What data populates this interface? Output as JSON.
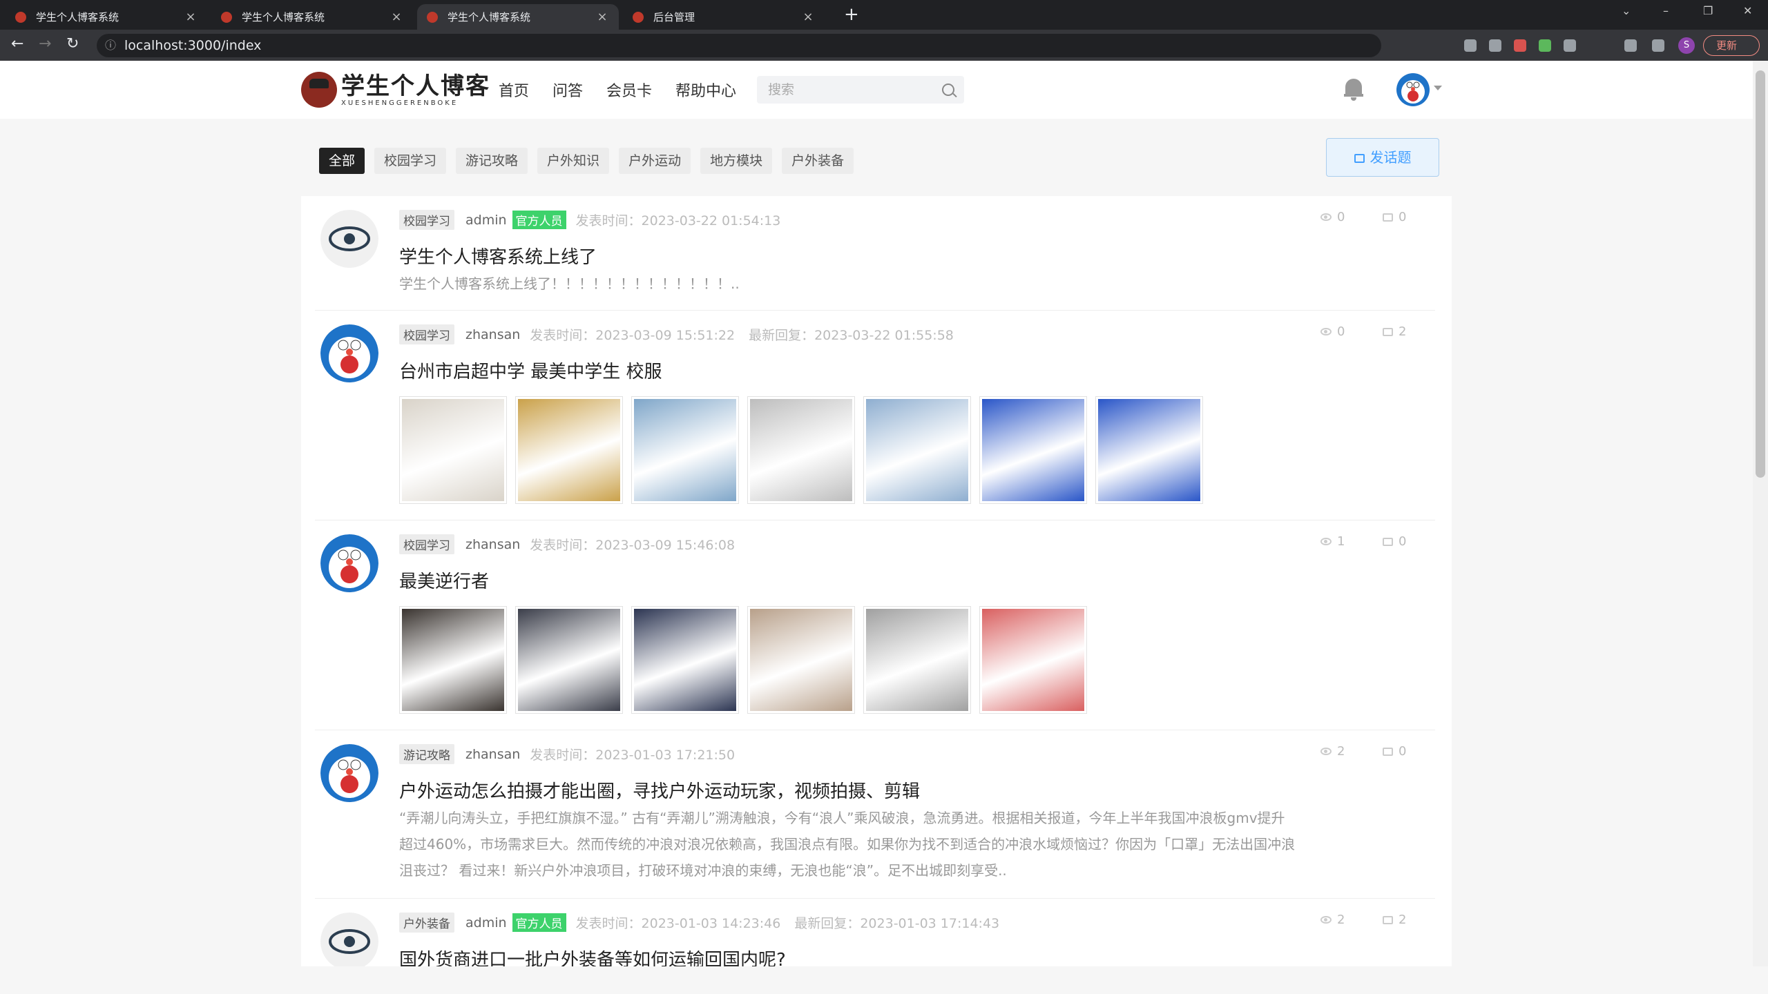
{
  "browser": {
    "tabs": [
      {
        "label": "学生个人博客系统"
      },
      {
        "label": "学生个人博客系统"
      },
      {
        "label": "学生个人博客系统"
      },
      {
        "label": "后台管理"
      }
    ],
    "new_tab": "+",
    "url": "localhost:3000/index",
    "profile_initial": "S",
    "update_label": "更新"
  },
  "site": {
    "logo_main": "学生个人博客",
    "logo_sub": "XUESHENGGERENBOKE",
    "nav": [
      "首页",
      "问答",
      "会员卡",
      "帮助中心"
    ],
    "search_placeholder": "搜索"
  },
  "categories": [
    "全部",
    "校园学习",
    "游记攻略",
    "户外知识",
    "户外运动",
    "地方模块",
    "户外装备"
  ],
  "post_button": "发话题",
  "posts": [
    {
      "tag": "校园学习",
      "author": "admin",
      "official": "官方人员",
      "time": "发表时间：2023-03-22 01:54:13",
      "reply": "",
      "views": "0",
      "comments": "0",
      "title": "学生个人博客系统上线了",
      "excerpt": "学生个人博客系统上线了！！！！！！！！！！！！！..",
      "images": []
    },
    {
      "tag": "校园学习",
      "author": "zhansan",
      "official": "",
      "time": "发表时间：2023-03-09 15:51:22",
      "reply": "最新回复：2023-03-22 01:55:58",
      "views": "0",
      "comments": "2",
      "title": "台州市启超中学 最美中学生 校服",
      "excerpt": "",
      "images": [
        "#d9d3c9",
        "#caa14a",
        "#7fa6c9",
        "#bdbdbd",
        "#8eaed0",
        "#2a56c8",
        "#2a56c8"
      ]
    },
    {
      "tag": "校园学习",
      "author": "zhansan",
      "official": "",
      "time": "发表时间：2023-03-09 15:46:08",
      "reply": "",
      "views": "1",
      "comments": "0",
      "title": "最美逆行者",
      "excerpt": "",
      "images": [
        "#3a3430",
        "#3b3e4a",
        "#2c3552",
        "#b8a08a",
        "#a0a0a0",
        "#d96060"
      ]
    },
    {
      "tag": "游记攻略",
      "author": "zhansan",
      "official": "",
      "time": "发表时间：2023-01-03 17:21:50",
      "reply": "",
      "views": "2",
      "comments": "0",
      "title": "户外运动怎么拍摄才能出圈，寻找户外运动玩家，视频拍摄、剪辑",
      "excerpt": "“弄潮儿向涛头立，手把红旗旗不湿。” 古有“弄潮儿”溯涛触浪，今有“浪人”乘风破浪，急流勇进。根据相关报道，今年上半年我国冲浪板gmv提升超过460%，市场需求巨大。然而传统的冲浪对浪况依赖高，我国浪点有限。如果你为找不到适合的冲浪水域烦恼过？你因为「口罩」无法出国冲浪沮丧过？ 看过来！新兴户外冲浪项目，打破环境对冲浪的束缚，无浪也能“浪”。足不出城即刻享受..",
      "images": []
    },
    {
      "tag": "户外装备",
      "author": "admin",
      "official": "官方人员",
      "time": "发表时间：2023-01-03 14:23:46",
      "reply": "最新回复：2023-01-03 17:14:43",
      "views": "2",
      "comments": "2",
      "title": "国外货商进口一批户外装备等如何运输回国内呢?",
      "excerpt": "",
      "images": []
    }
  ],
  "colors": {
    "accent": "#409eff",
    "official": "#3dd26b",
    "dark": "#222222"
  }
}
